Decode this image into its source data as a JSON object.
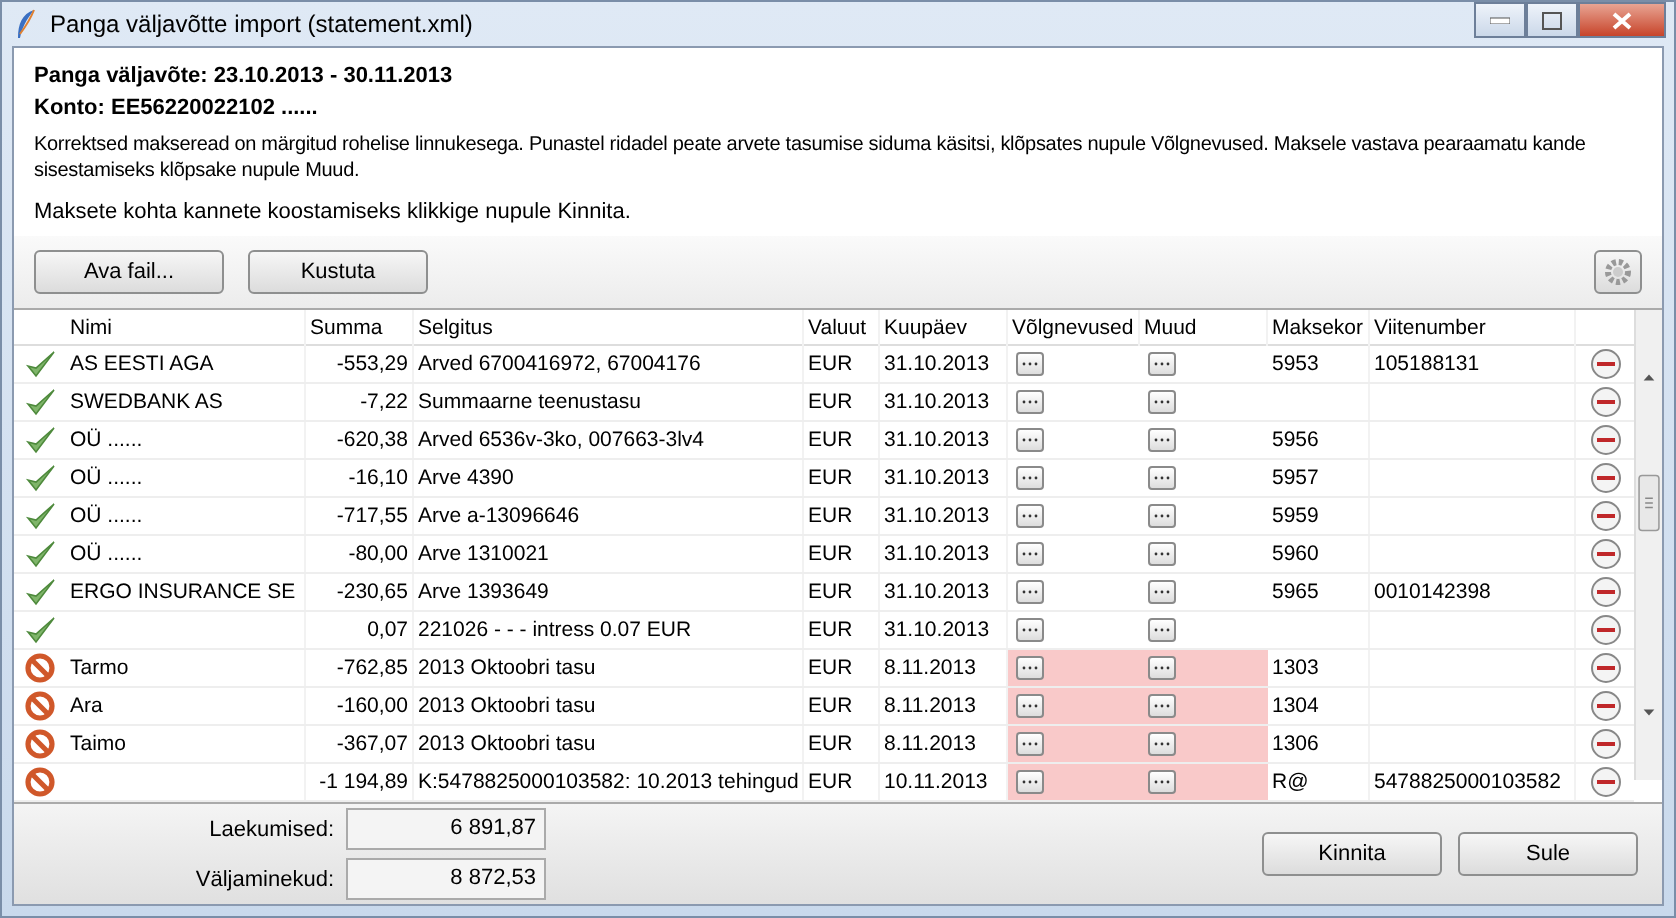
{
  "window": {
    "title": "Panga väljavõtte import (statement.xml)"
  },
  "header": {
    "period": "Panga väljavõte: 23.10.2013 - 30.11.2013",
    "account": "Konto: EE56220022102 ......",
    "description_lines": [
      "Korrektsed makseread on märgitud rohelise linnukesega. Punastel ridadel peate arvete tasumise siduma käsitsi, klõpsates nupule Võlgnevused. Maksele vastava pearaamatu kande",
      "sisestamiseks klõpsake nupule Muud."
    ],
    "hint": "Maksete kohta kannete koostamiseks klikkige nupule Kinnita."
  },
  "toolbar": {
    "buttons": [
      "Ava fail...",
      "Kustuta"
    ]
  },
  "table": {
    "columns": [
      "Nimi",
      "Summa",
      "Selgitus",
      "Valuut",
      "Kuupäev",
      "Võlgnevused",
      "Muud",
      "Maksekor",
      "Viitenumber"
    ],
    "rows": [
      {
        "kind": "ok",
        "name": "AS EESTI AGA",
        "amount": "-553,29",
        "description": "Arved 6700416972, 67004176",
        "currency": "EUR",
        "date": "31.10.2013",
        "doc": "5953",
        "ref": "105188131"
      },
      {
        "kind": "ok",
        "name": "SWEDBANK AS",
        "amount": "-7,22",
        "description": "Summaarne teenustasu",
        "currency": "EUR",
        "date": "31.10.2013"
      },
      {
        "kind": "ok",
        "name": "OÜ ......",
        "amount": "-620,38",
        "description": "Arved 6536v-3ko, 007663-3lv4",
        "currency": "EUR",
        "date": "31.10.2013",
        "doc": "5956"
      },
      {
        "kind": "ok",
        "name": "OÜ ......",
        "amount": "-16,10",
        "description": "Arve 4390",
        "currency": "EUR",
        "date": "31.10.2013",
        "doc": "5957"
      },
      {
        "kind": "ok",
        "name": "OÜ ......",
        "amount": "-717,55",
        "description": "Arve a-13096646",
        "currency": "EUR",
        "date": "31.10.2013",
        "doc": "5959"
      },
      {
        "kind": "ok",
        "name": "OÜ ......",
        "amount": "-80,00",
        "description": "Arve 1310021",
        "currency": "EUR",
        "date": "31.10.2013",
        "doc": "5960"
      },
      {
        "kind": "ok",
        "name": "ERGO INSURANCE SE",
        "amount": "-230,65",
        "description": "Arve 1393649",
        "currency": "EUR",
        "date": "31.10.2013",
        "doc": "5965",
        "ref": "0010142398"
      },
      {
        "kind": "ok",
        "amount": "0,07",
        "description": "221026 - - -  intress 0.07 EUR",
        "currency": "EUR",
        "date": "31.10.2013"
      },
      {
        "kind": "error",
        "name": "Tarmo",
        "amount": "-762,85",
        "description": "2013 Oktoobri tasu",
        "currency": "EUR",
        "date": "8.11.2013",
        "doc": "1303"
      },
      {
        "kind": "error",
        "name": "Ara",
        "amount": "-160,00",
        "description": "2013 Oktoobri tasu",
        "currency": "EUR",
        "date": "8.11.2013",
        "doc": "1304"
      },
      {
        "kind": "error",
        "name": "Taimo",
        "amount": "-367,07",
        "description": "2013 Oktoobri tasu",
        "currency": "EUR",
        "date": "8.11.2013",
        "doc": "1306"
      },
      {
        "kind": "error",
        "amount": "-1 194,89",
        "description": "K:5478825000103582: 10.2013  tehingud",
        "currency": "EUR",
        "date": "10.11.2013",
        "doc": "R@",
        "ref": "5478825000103582"
      }
    ]
  },
  "totals": [
    {
      "label": "Laekumised:",
      "value": "6 891,87"
    },
    {
      "label": "Väljaminekud:",
      "value": "8 872,53"
    }
  ],
  "actions": [
    "Kinnita",
    "Sule"
  ]
}
